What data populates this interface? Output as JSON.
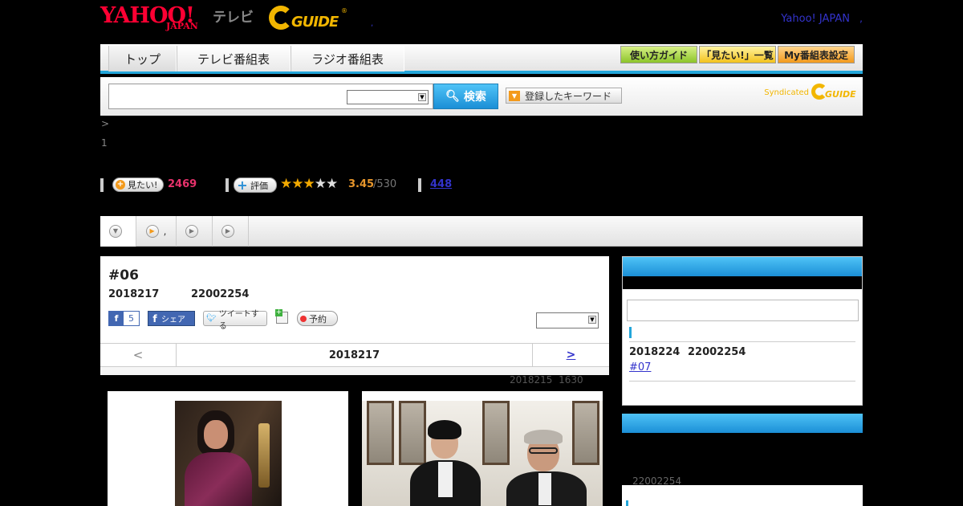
{
  "header": {
    "logo_yahoo": "YAHOO!",
    "logo_japan": "JAPAN",
    "logo_tv": "テレビ",
    "logo_gguide": "GUIDE",
    "logo_gguide_reg": "®",
    "separator": ",",
    "yahoo_japan_link": "Yahoo! JAPAN",
    "yahoo_japan_sep": ","
  },
  "nav": {
    "tabs": [
      {
        "label": "トップ"
      },
      {
        "label": "テレビ番組表"
      },
      {
        "label": "ラジオ番組表"
      }
    ],
    "buttons": [
      {
        "label": "使い方ガイド",
        "color": "#8cc42a"
      },
      {
        "label": "「見たい!」一覧",
        "color": "#f3c21c"
      },
      {
        "label": "My番組表設定",
        "color": "#f39a1c"
      }
    ]
  },
  "search": {
    "input_value": "",
    "select_value": "",
    "button_label": "検索",
    "keyword_button_label": "登録したキーワード",
    "syndicated_text": "Syndicated",
    "syndicated_logo": "GUIDE"
  },
  "breadcrumb": {
    "text": ">",
    "line2": "1"
  },
  "stats": {
    "mitai_label": "見たい!",
    "mitai_count": "2469",
    "hyoka_label": "評価",
    "rating_stars": 3.45,
    "rating_value": "3.45",
    "rating_count": "/530",
    "review_count": "448",
    "accent_color": "#e8326c"
  },
  "subtabs": [
    {
      "label": "",
      "icon": "chevron-down-icon"
    },
    {
      "label": ",",
      "icon": "play-icon"
    },
    {
      "label": "",
      "icon": "play-icon"
    },
    {
      "label": "",
      "icon": "play-icon"
    }
  ],
  "episode": {
    "title": "#06",
    "date": "2018217",
    "time": "22002254",
    "fb_like_count": "5",
    "fb_share_label": "シェア",
    "tweet_label": "ツイートする",
    "yoyaku_label": "予約",
    "select_value": "",
    "nav_prev": "<",
    "nav_current": "2018217",
    "nav_next": ">",
    "updated_date": "2018215",
    "updated_time": "1630"
  },
  "photos": [
    {
      "icon": "actress-portrait-photo"
    },
    {
      "icon": "two-men-in-tuxedos-photo"
    }
  ],
  "sidebar": {
    "box1": {
      "input_value": "",
      "next_date": "2018224",
      "next_time": "22002254",
      "next_episode": "#07"
    },
    "box2": {
      "time": "22002254"
    },
    "accent_color": "#1b8fd6"
  }
}
